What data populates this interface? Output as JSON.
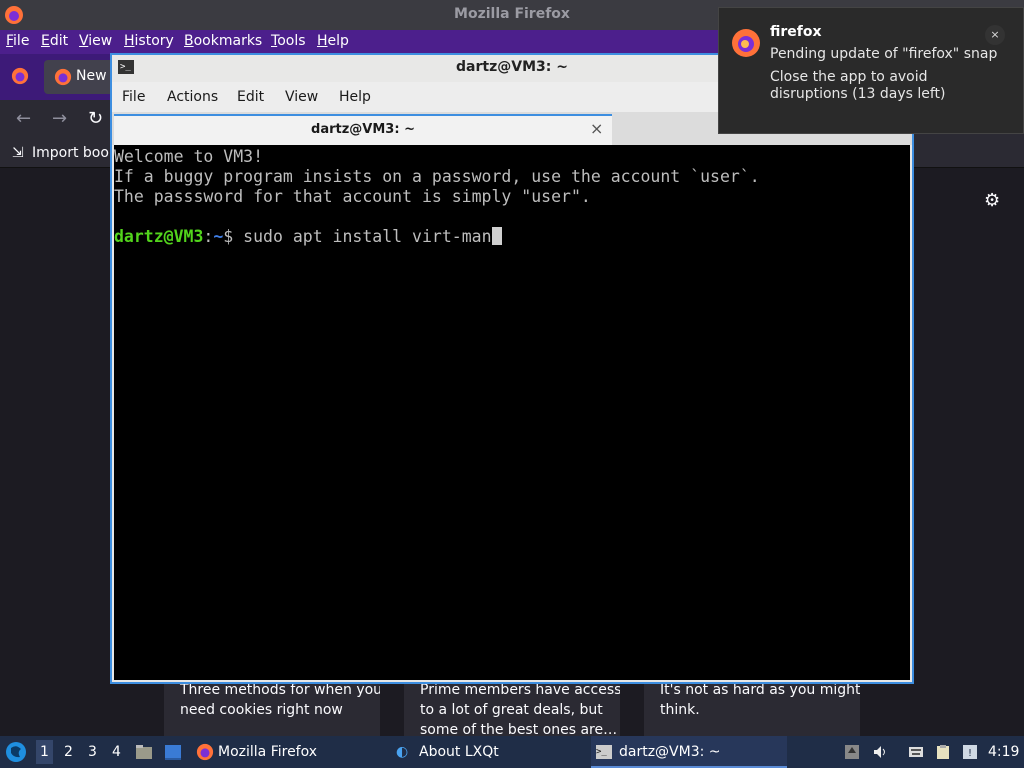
{
  "firefox": {
    "window_title": "Mozilla Firefox",
    "menu": [
      "File",
      "Edit",
      "View",
      "History",
      "Bookmarks",
      "Tools",
      "Help"
    ],
    "tab_label": "New",
    "bookmark_label": "Import book",
    "cards": [
      {
        "line1": "Three methods for when you",
        "line2": "need cookies right now"
      },
      {
        "line1": "Prime members have access",
        "line2": "to a lot of great deals, but",
        "line3": "some of the best ones are…"
      },
      {
        "line1": "It's not as hard as you might",
        "line2": "think."
      }
    ]
  },
  "terminal": {
    "window_title": "dartz@VM3: ~",
    "menu": [
      "File",
      "Actions",
      "Edit",
      "View",
      "Help"
    ],
    "tab_label": "dartz@VM3: ~",
    "tab_close": "×",
    "lines": [
      "Welcome to VM3!",
      "If a buggy program insists on a password, use the account `user`.",
      "The passsword for that account is simply \"user\"."
    ],
    "prompt_user": "dartz@VM3",
    "prompt_sep": ":",
    "prompt_path": "~",
    "prompt_symbol": "$ ",
    "command": "sudo apt install virt-man"
  },
  "notification": {
    "app": "firefox",
    "message": "Pending update of \"firefox\" snap",
    "detail": "Close the app to avoid disruptions (13 days left)",
    "close": "×"
  },
  "taskbar": {
    "workspaces": [
      "1",
      "2",
      "3",
      "4"
    ],
    "tasks": [
      "Mozilla Firefox",
      "About LXQt",
      "dartz@VM3: ~"
    ],
    "clock": "4:19"
  },
  "colors": {
    "firefox_menubar": "#4c1f8c",
    "terminal_focus": "#3d8ee0",
    "prompt_user": "#52d41c",
    "prompt_path": "#3f7ee6",
    "taskbar": "#1f2d47"
  }
}
